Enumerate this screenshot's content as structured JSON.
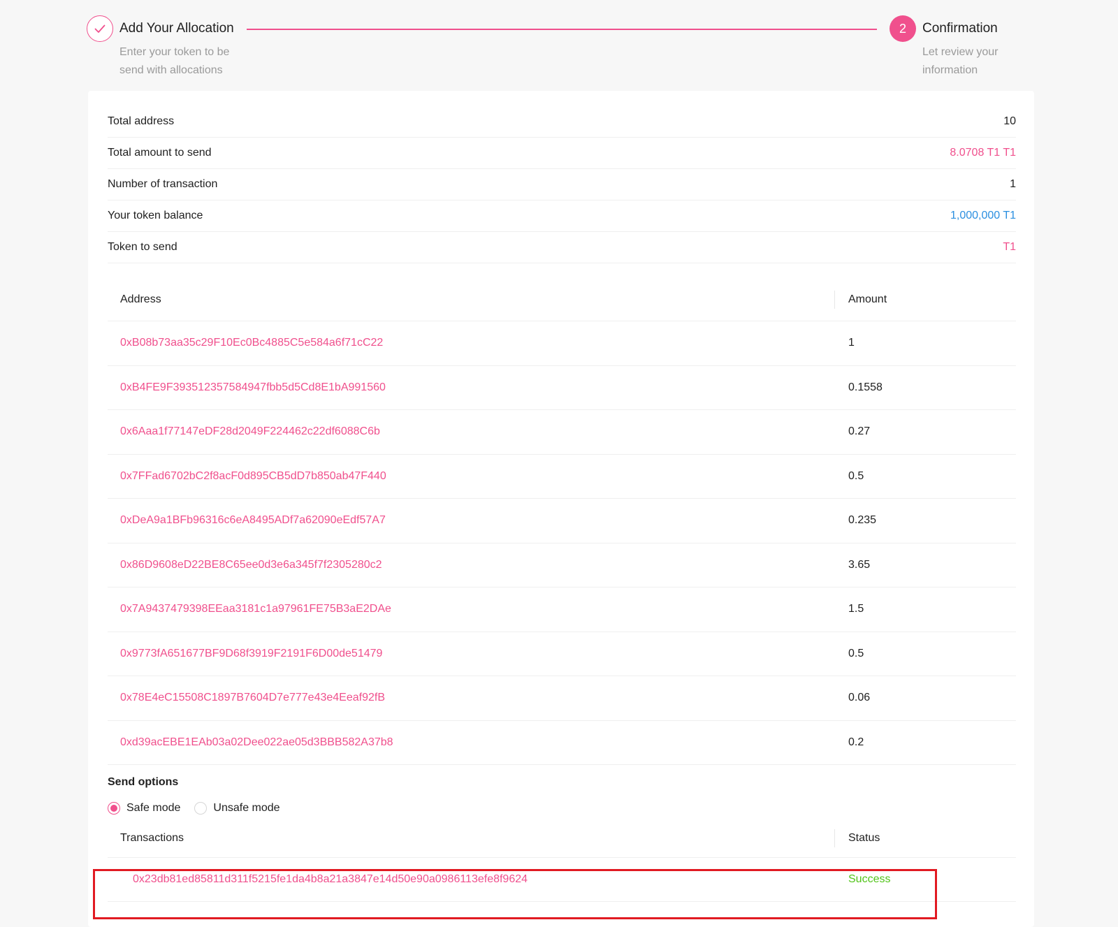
{
  "steps": [
    {
      "title": "Add Your Allocation",
      "desc": "Enter your token to be send with allocations",
      "state": "done",
      "icon": "check-icon"
    },
    {
      "number": "2",
      "title": "Confirmation",
      "desc": "Let review your information",
      "state": "active"
    }
  ],
  "summary": {
    "rows": [
      {
        "label": "Total address",
        "value": "10"
      },
      {
        "label": "Total amount to send",
        "value": "8.0708 T1 T1"
      },
      {
        "label": "Number of transaction",
        "value": "1"
      },
      {
        "label": "Your token balance",
        "value": "1,000,000 T1"
      },
      {
        "label": "Token to send",
        "value": "T1"
      }
    ]
  },
  "allocations": {
    "headers": {
      "address": "Address",
      "amount": "Amount"
    },
    "rows": [
      {
        "address": "0xB08b73aa35c29F10Ec0Bc4885C5e584a6f71cC22",
        "amount": "1"
      },
      {
        "address": "0xB4FE9F393512357584947fbb5d5Cd8E1bA991560",
        "amount": "0.1558"
      },
      {
        "address": "0x6Aaa1f77147eDF28d2049F224462c22df6088C6b",
        "amount": "0.27"
      },
      {
        "address": "0x7FFad6702bC2f8acF0d895CB5dD7b850ab47F440",
        "amount": "0.5"
      },
      {
        "address": "0xDeA9a1BFb96316c6eA8495ADf7a62090eEdf57A7",
        "amount": "0.235"
      },
      {
        "address": "0x86D9608eD22BE8C65ee0d3e6a345f7f2305280c2",
        "amount": "3.65"
      },
      {
        "address": "0x7A9437479398EEaa3181c1a97961FE75B3aE2DAe",
        "amount": "1.5"
      },
      {
        "address": "0x9773fA651677BF9D68f3919F2191F6D00de51479",
        "amount": "0.5"
      },
      {
        "address": "0x78E4eC15508C1897B7604D7e777e43e4Eeaf92fB",
        "amount": "0.06"
      },
      {
        "address": "0xd39acEBE1EAb03a02Dee022ae05d3BBB582A37b8",
        "amount": "0.2"
      }
    ]
  },
  "send_options": {
    "title": "Send options",
    "options": [
      {
        "label": "Safe mode",
        "checked": true
      },
      {
        "label": "Unsafe mode",
        "checked": false
      }
    ]
  },
  "transactions": {
    "headers": {
      "tx": "Transactions",
      "status": "Status"
    },
    "rows": [
      {
        "hash": "0x23db81ed85811d311f5215fe1da4b8a21a3847e14d50e90a0986113efe8f9624",
        "status": "Success"
      }
    ]
  },
  "colors": {
    "accent": "#f0508d",
    "link_blue": "#2b8fe0",
    "success": "#52c41a",
    "highlight": "#e11a22"
  }
}
